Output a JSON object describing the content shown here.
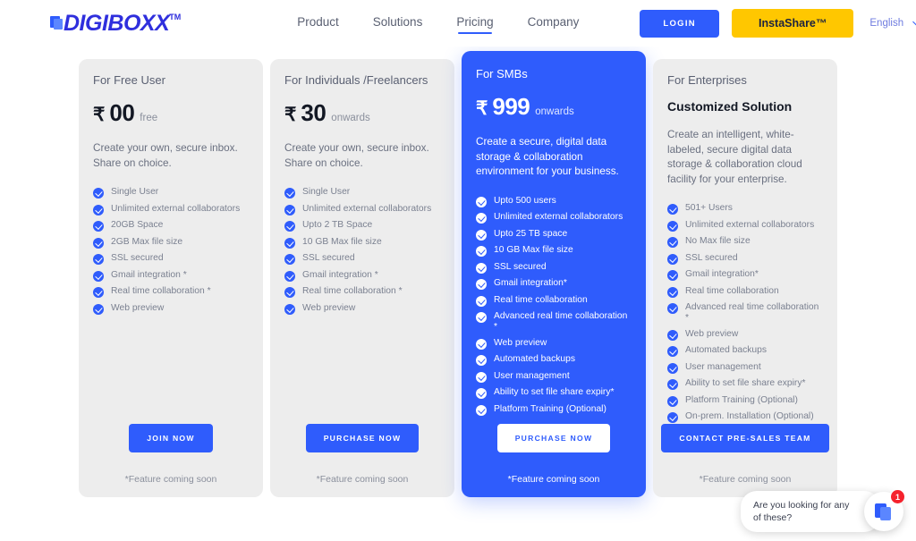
{
  "header": {
    "logo_text": "DIGIBOXX",
    "logo_tm": "TM",
    "nav": [
      {
        "label": "Product",
        "active": false
      },
      {
        "label": "Solutions",
        "active": false
      },
      {
        "label": "Pricing",
        "active": true
      },
      {
        "label": "Company",
        "active": false
      }
    ],
    "login_label": "LOGIN",
    "instashare_label": "InstaShare™",
    "language": "English"
  },
  "cards": [
    {
      "audience": "For Free User",
      "currency": "₹",
      "amount": "00",
      "suffix": "free",
      "custom_price": null,
      "description": "Create your own, secure inbox. Share on choice.",
      "features": [
        "Single User",
        "Unlimited external collaborators",
        "20GB Space",
        "2GB Max file size",
        "SSL secured",
        "Gmail integration *",
        "Real time collaboration *",
        "Web preview"
      ],
      "cta_label": "JOIN NOW",
      "footnote": "*Feature coming soon",
      "featured": false
    },
    {
      "audience": "For Individuals /Freelancers",
      "currency": "₹",
      "amount": "30",
      "suffix": "onwards",
      "custom_price": null,
      "description": "Create your own, secure inbox. Share on choice.",
      "features": [
        "Single User",
        "Unlimited external collaborators",
        "Upto 2 TB Space",
        "10 GB Max file size",
        "SSL secured",
        "Gmail integration *",
        "Real time collaboration *",
        "Web preview"
      ],
      "cta_label": "PURCHASE NOW",
      "footnote": "*Feature coming soon",
      "featured": false
    },
    {
      "audience": "For SMBs",
      "currency": "₹",
      "amount": "999",
      "suffix": "onwards",
      "custom_price": null,
      "description": "Create a secure, digital data storage & collaboration environment for your business.",
      "features": [
        "Upto 500 users",
        "Unlimited external collaborators",
        "Upto 25 TB space",
        "10 GB Max file size",
        "SSL secured",
        "Gmail integration*",
        "Real time collaboration",
        "Advanced real time collaboration *",
        "Web preview",
        "Automated backups",
        "User management",
        "Ability to set file share expiry*",
        "Platform Training (Optional)"
      ],
      "cta_label": "PURCHASE NOW",
      "footnote": "*Feature coming soon",
      "featured": true
    },
    {
      "audience": "For Enterprises",
      "currency": null,
      "amount": null,
      "suffix": null,
      "custom_price": "Customized Solution",
      "description": "Create an intelligent, white-labeled, secure digital data storage & collaboration cloud facility for your enterprise.",
      "features": [
        "501+ Users",
        "Unlimited external collaborators",
        "No Max file size",
        "SSL secured",
        "Gmail integration*",
        "Real time collaboration",
        "Advanced real time collaboration *",
        "Web preview",
        "Automated backups",
        "User management",
        "Ability to set file share expiry*",
        "Platform Training (Optional)",
        "On-prem. Installation (Optional)"
      ],
      "cta_label": "CONTACT PRE-SALES TEAM",
      "footnote": "*Feature coming soon",
      "featured": false
    }
  ],
  "chat": {
    "message": "Are you looking for any of these?",
    "badge_count": "1"
  },
  "colors": {
    "brand_blue": "#2f5cfc",
    "accent_yellow": "#ffc700",
    "card_gray": "#ededed",
    "badge_red": "#f5222d"
  }
}
